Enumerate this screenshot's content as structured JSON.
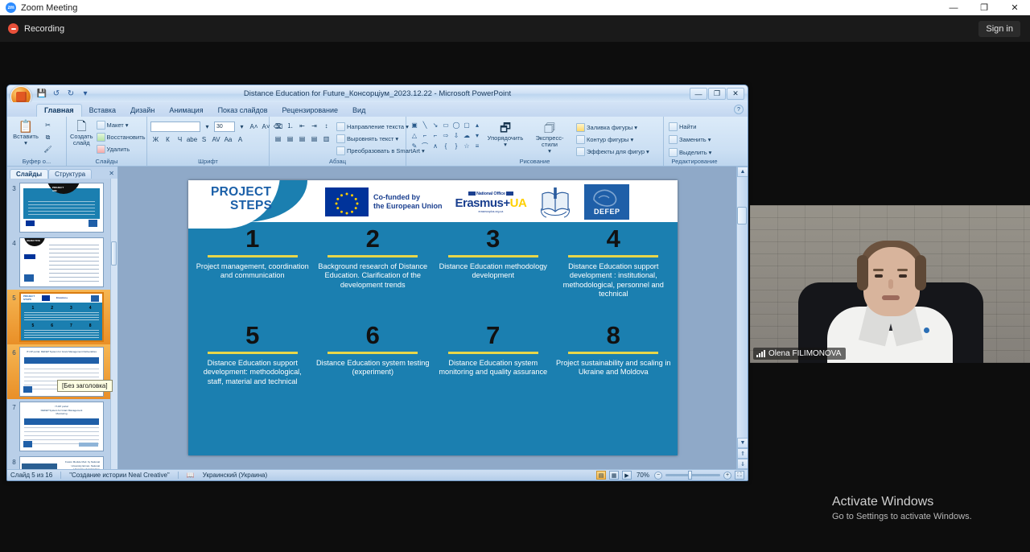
{
  "zoom_app": {
    "window_title": "Zoom Meeting",
    "logo_text": "zm",
    "minimize": "—",
    "maximize": "❐",
    "close": "✕",
    "recording_label": "Recording",
    "sign_in_label": "Sign in"
  },
  "powerpoint": {
    "title": "Distance Education for Future_Консорціум_2023.12.22 - Microsoft PowerPoint",
    "quick_access": [
      "save-icon",
      "undo-icon",
      "redo-icon",
      "customize-icon"
    ],
    "window_buttons": {
      "minimize": "—",
      "restore": "❐",
      "close": "✕"
    },
    "help_button": "?",
    "tabs": [
      {
        "label": "Главная",
        "active": true
      },
      {
        "label": "Вставка",
        "active": false
      },
      {
        "label": "Дизайн",
        "active": false
      },
      {
        "label": "Анимация",
        "active": false
      },
      {
        "label": "Показ слайдов",
        "active": false
      },
      {
        "label": "Рецензирование",
        "active": false
      },
      {
        "label": "Вид",
        "active": false
      }
    ],
    "ribbon_groups": [
      {
        "name": "clipboard",
        "label": "Буфер о...",
        "big_button": {
          "label": "Вставить",
          "icon": "paste-icon"
        },
        "small_buttons": [
          "Вырезать",
          "Копировать",
          "Формат по образцу"
        ]
      },
      {
        "name": "slides",
        "label": "Слайды",
        "big_button": {
          "label": "Создать слайд",
          "icon": "new-slide-icon"
        },
        "small_buttons": [
          "Макет",
          "Восстановить",
          "Удалить"
        ]
      },
      {
        "name": "font",
        "label": "Шрифт",
        "font_name": "",
        "font_size": "30",
        "buttons": [
          "Ж",
          "К",
          "Ч",
          "abe",
          "S",
          "AV",
          "Aa",
          "A"
        ]
      },
      {
        "name": "paragraph",
        "label": "Абзац",
        "buttons": [
          "Направление текста",
          "Выровнять текст",
          "Преобразовать в SmartArt"
        ]
      },
      {
        "name": "drawing",
        "label": "Рисование",
        "arrange_label": "Упорядочить",
        "quickstyles_label": "Экспресс-стили",
        "shape_fill": "Заливка фигуры",
        "shape_outline": "Контур фигуры",
        "shape_effects": "Эффекты для фигур"
      },
      {
        "name": "editing",
        "label": "Редактирование",
        "find": "Найти",
        "replace": "Заменить",
        "select": "Выделить"
      }
    ],
    "slide_panel": {
      "tabs": [
        {
          "label": "Слайды",
          "active": true
        },
        {
          "label": "Структура",
          "active": false
        }
      ],
      "close": "✕",
      "thumbnails": [
        {
          "number": "3",
          "selected": false
        },
        {
          "number": "4",
          "selected": false
        },
        {
          "number": "5",
          "selected": true
        },
        {
          "number": "6",
          "selected": false
        },
        {
          "number": "7",
          "selected": false
        },
        {
          "number": "8",
          "selected": false
        }
      ],
      "tooltip": "[Без заголовка]"
    },
    "status_bar": {
      "slide_counter": "Слайд 5 из 16",
      "theme_name": "\"Создание истории Neal Creative\"",
      "language": "Украинский (Украина)",
      "zoom_level": "70%",
      "zoom_out": "−",
      "zoom_in": "+",
      "fit_label": "⛶"
    }
  },
  "slide": {
    "title_line1": "PROJECT",
    "title_line2": "STEPS",
    "logos": {
      "eu_text_line1": "Co-funded by",
      "eu_text_line2": "the European Union",
      "erasmus_national_office": "National Office",
      "erasmus_main": "Erasmus+",
      "erasmus_ua": "UA",
      "erasmus_url": "erasmusplus.org.ua",
      "defep": "DEFEP"
    },
    "steps": [
      {
        "number": "1",
        "text": "Project management, coordination and communication"
      },
      {
        "number": "2",
        "text": "Background research of Distance Education. Clarification of the development trends"
      },
      {
        "number": "3",
        "text": "Distance Education methodology development"
      },
      {
        "number": "4",
        "text": "Distance Education support development : institutional, methodological, personnel and technical"
      },
      {
        "number": "5",
        "text": "Distance Education support development: methodological, staff, material and technical"
      },
      {
        "number": "6",
        "text": "Distance Education system testing (experiment)"
      },
      {
        "number": "7",
        "text": "Distance Education system monitoring and quality assurance"
      },
      {
        "number": "8",
        "text": "Project sustainability and scaling in Ukraine and Moldova"
      }
    ],
    "colors": {
      "background": "#1b7fb0",
      "accent_rule": "#e8d64a",
      "number": "#111111",
      "title": "#1a5fa8"
    }
  },
  "video": {
    "participant_name": "Olena FILIMONOVA",
    "signal_icon": "signal-bars-icon"
  },
  "watermark": {
    "title": "Activate Windows",
    "subtitle": "Go to Settings to activate Windows."
  }
}
